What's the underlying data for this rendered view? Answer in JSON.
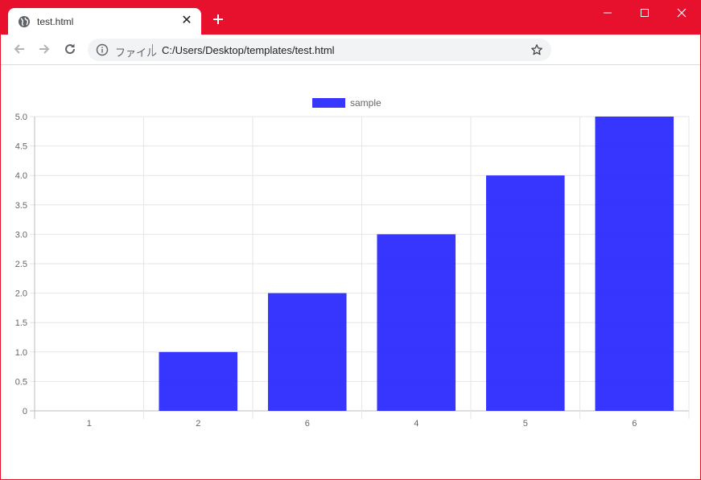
{
  "browser": {
    "tab": {
      "title": "test.html",
      "close_glyph": "✕"
    },
    "new_tab_icon": "plus-icon",
    "window_controls": [
      "minimize-icon",
      "maximize-icon",
      "close-icon"
    ],
    "address_bar": {
      "scheme_label": "ファイル",
      "url": "C:/Users/Desktop/templates/test.html"
    },
    "colors": {
      "titlebar": "#e8112d",
      "toolbar": "#ffffff",
      "omnibox": "#f1f3f4"
    }
  },
  "chart_data": {
    "type": "bar",
    "categories": [
      "1",
      "2",
      "6",
      "4",
      "5",
      "6"
    ],
    "series": [
      {
        "name": "sample",
        "values": [
          0,
          1,
          2,
          3,
          4,
          5
        ],
        "color": "#1a1aff"
      }
    ],
    "ylim": [
      0,
      5
    ],
    "y_ticks": [
      "0",
      "0.5",
      "1.0",
      "1.5",
      "2.0",
      "2.5",
      "3.0",
      "3.5",
      "4.0",
      "4.5",
      "5.0"
    ],
    "grid": true,
    "legend_position": "top",
    "title": "",
    "xlabel": "",
    "ylabel": ""
  }
}
